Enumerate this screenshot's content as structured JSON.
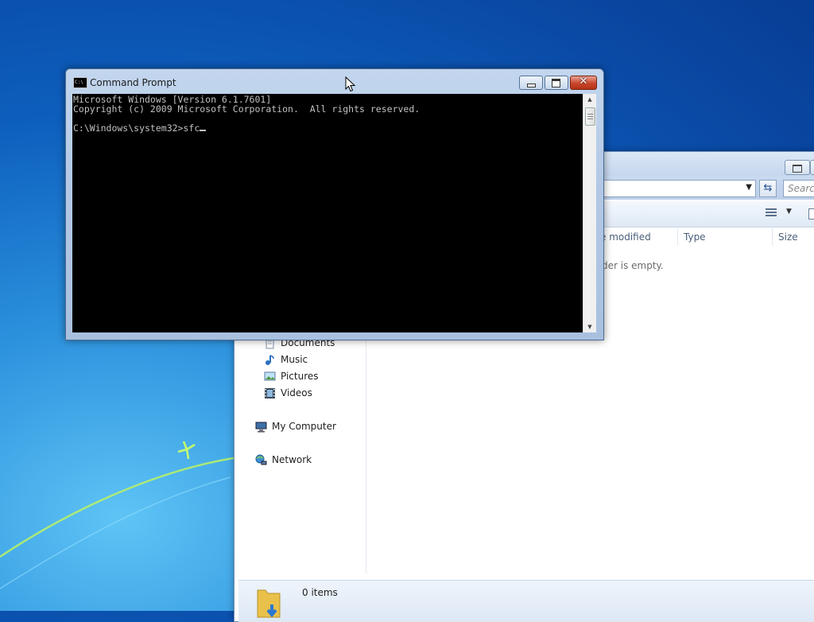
{
  "cmd": {
    "title": "Command Prompt",
    "icon_text": "C:\\",
    "lines": [
      "Microsoft Windows [Version 6.1.7601]",
      "Copyright (c) 2009 Microsoft Corporation.  All rights reserved.",
      "",
      "C:\\Windows\\system32>sfc"
    ]
  },
  "explorer": {
    "search_placeholder": "Search",
    "columns": {
      "date_modified": "e modified",
      "type": "Type",
      "size": "Size"
    },
    "empty_message": "der is empty.",
    "nav": {
      "documents": "Documents",
      "music": "Music",
      "pictures": "Pictures",
      "videos": "Videos",
      "my_computer": "My Computer",
      "network": "Network"
    },
    "status": {
      "items": "0 items"
    }
  },
  "icons": {
    "cmd_icon": "cmd-icon",
    "minimize": "minimize-icon",
    "maximize": "maximize-icon",
    "close": "close-icon",
    "refresh": "refresh-icon",
    "views": "views-icon",
    "folder": "folder-icon",
    "cursor": "mouse-pointer-icon"
  }
}
